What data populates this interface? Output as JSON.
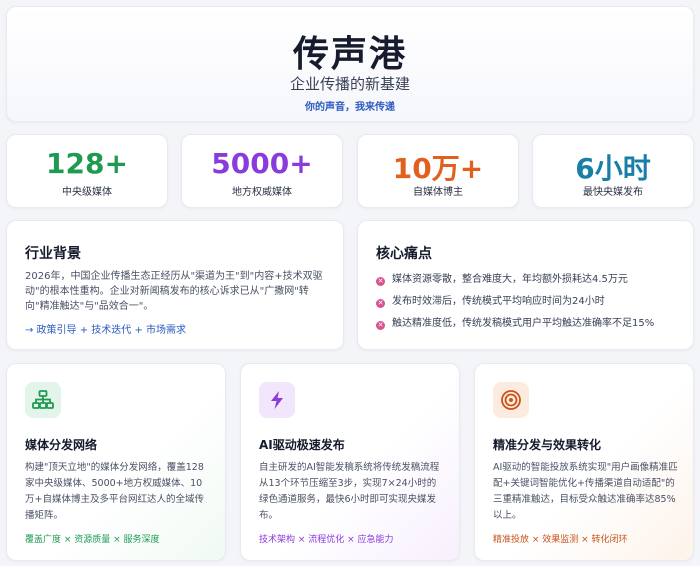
{
  "hero": {
    "title": "传声港",
    "subtitle": "企业传播的新基建",
    "tagline": "你的声音，我来传递"
  },
  "stats": [
    {
      "value": "128+",
      "label": "中央级媒体",
      "color": "#1f9a52"
    },
    {
      "value": "5000+",
      "label": "地方权威媒体",
      "color": "#8a3bdc"
    },
    {
      "value": "10万+",
      "label": "自媒体博主",
      "color": "#e0601c"
    },
    {
      "value": "6小时",
      "label": "最快央媒发布",
      "color": "#1a7fa6"
    }
  ],
  "background": {
    "title": "行业背景",
    "text": "2026年，中国企业传播生态正经历从\"渠道为王\"到\"内容+技术双驱动\"的根本性重构。企业对新闻稿发布的核心诉求已从\"广撒网\"转向\"精准触达\"与\"品效合一\"。",
    "link": "→ 政策引导 + 技术迭代 + 市场需求"
  },
  "pain_points": {
    "title": "核心痛点",
    "items": [
      "媒体资源零散，整合难度大，年均额外损耗达4.5万元",
      "发布时效滞后，传统模式平均响应时间为24小时",
      "触达精准度低，传统发稿模式用户平均触达准确率不足15%"
    ],
    "icon_color": "#d9538f"
  },
  "features": [
    {
      "icon": "network-icon",
      "title": "媒体分发网络",
      "text": "构建\"顶天立地\"的媒体分发网络，覆盖128家中央级媒体、5000+地方权威媒体、10万+自媒体博主及多平台网红达人的全域传播矩阵。",
      "tags": "覆盖广度 × 资源质量 × 服务深度",
      "color": "#1f9a52",
      "icon_bg": "#e3f5ea"
    },
    {
      "icon": "lightning-icon",
      "title": "AI驱动极速发布",
      "text": "自主研发的AI智能发稿系统将传统发稿流程从13个环节压缩至3步，实现7×24小时的绿色通道服务，最快6小时即可实现央媒发布。",
      "tags": "技术架构 × 流程优化 × 应急能力",
      "color": "#8a3bdc",
      "icon_bg": "#f1e6fc"
    },
    {
      "icon": "target-icon",
      "title": "精准分发与效果转化",
      "text": "AI驱动的智能投放系统实现\"用户画像精准匹配+关键词智能优化+传播渠道自动适配\"的三重精准触达，目标受众触达准确率达85%以上。",
      "tags": "精准投放 × 效果监测 × 转化闭环",
      "color": "#c9541a",
      "icon_bg": "#fcecdf"
    }
  ]
}
